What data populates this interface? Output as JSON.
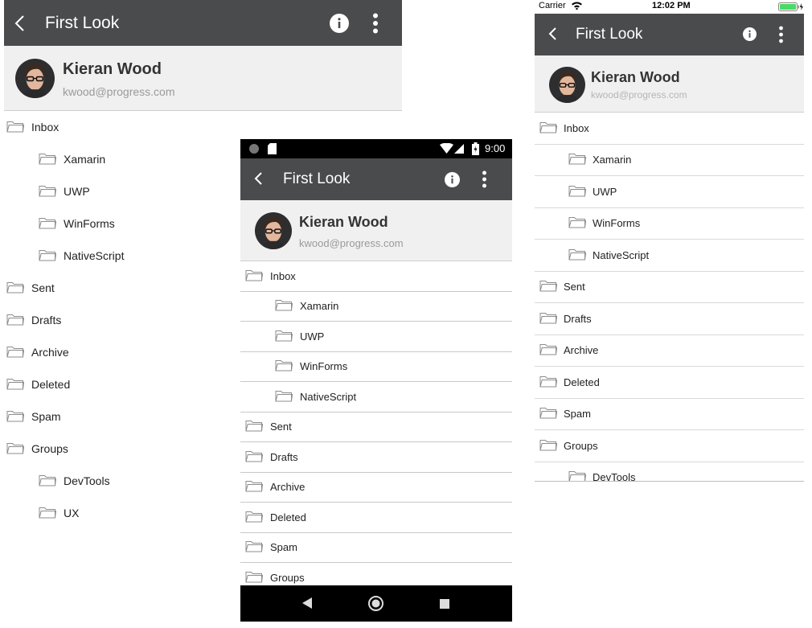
{
  "app": {
    "title": "First Look",
    "user": {
      "name": "Kieran Wood",
      "email": "kwood@progress.com"
    }
  },
  "colors": {
    "toolbar": "#4a4b4d",
    "profile_bg": "#f0f0f0",
    "divider": "#c8c8c8",
    "battery": "#4cd964"
  },
  "icons": {
    "back": "chevron-left-icon",
    "info": "info-icon",
    "more": "more-vertical-icon",
    "folder": "folder-icon"
  },
  "uwp": {
    "folders": [
      {
        "label": "Inbox",
        "level": 0
      },
      {
        "label": "Xamarin",
        "level": 1
      },
      {
        "label": "UWP",
        "level": 1
      },
      {
        "label": "WinForms",
        "level": 1
      },
      {
        "label": "NativeScript",
        "level": 1
      },
      {
        "label": "Sent",
        "level": 0
      },
      {
        "label": "Drafts",
        "level": 0
      },
      {
        "label": "Archive",
        "level": 0
      },
      {
        "label": "Deleted",
        "level": 0
      },
      {
        "label": "Spam",
        "level": 0
      },
      {
        "label": "Groups",
        "level": 0
      },
      {
        "label": "DevTools",
        "level": 1
      },
      {
        "label": "UX",
        "level": 1
      }
    ]
  },
  "android": {
    "status": {
      "time": "9:00"
    },
    "folders": [
      {
        "label": "Inbox",
        "level": 0
      },
      {
        "label": "Xamarin",
        "level": 1
      },
      {
        "label": "UWP",
        "level": 1
      },
      {
        "label": "WinForms",
        "level": 1
      },
      {
        "label": "NativeScript",
        "level": 1
      },
      {
        "label": "Sent",
        "level": 0
      },
      {
        "label": "Drafts",
        "level": 0
      },
      {
        "label": "Archive",
        "level": 0
      },
      {
        "label": "Deleted",
        "level": 0
      },
      {
        "label": "Spam",
        "level": 0
      },
      {
        "label": "Groups",
        "level": 0
      }
    ]
  },
  "ios": {
    "status": {
      "carrier": "Carrier",
      "time": "12:02 PM"
    },
    "folders": [
      {
        "label": "Inbox",
        "level": 0
      },
      {
        "label": "Xamarin",
        "level": 1
      },
      {
        "label": "UWP",
        "level": 1
      },
      {
        "label": "WinForms",
        "level": 1
      },
      {
        "label": "NativeScript",
        "level": 1
      },
      {
        "label": "Sent",
        "level": 0
      },
      {
        "label": "Drafts",
        "level": 0
      },
      {
        "label": "Archive",
        "level": 0
      },
      {
        "label": "Deleted",
        "level": 0
      },
      {
        "label": "Spam",
        "level": 0
      },
      {
        "label": "Groups",
        "level": 0
      },
      {
        "label": "DevTools",
        "level": 1
      }
    ]
  }
}
